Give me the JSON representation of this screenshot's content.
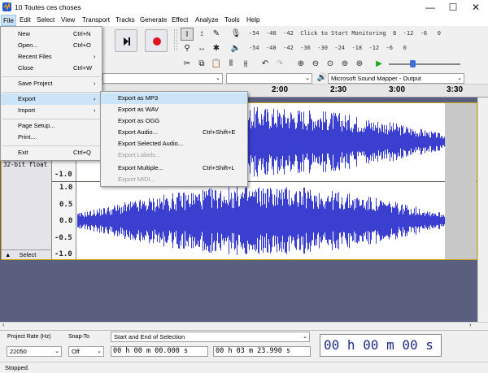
{
  "window": {
    "title": "10 Toutes ces choses",
    "minimize": "—",
    "maximize": "☐",
    "close": "✕"
  },
  "menubar": {
    "items": [
      "File",
      "Edit",
      "Select",
      "View",
      "Transport",
      "Tracks",
      "Generate",
      "Effect",
      "Analyze",
      "Tools",
      "Help"
    ]
  },
  "file_menu": {
    "items": [
      {
        "label": "New",
        "shortcut": "Ctrl+N"
      },
      {
        "label": "Open...",
        "shortcut": "Ctrl+O"
      },
      {
        "label": "Recent Files",
        "shortcut": "›"
      },
      {
        "label": "Close",
        "shortcut": "Ctrl+W"
      },
      {
        "label": "Save Project",
        "shortcut": "›"
      },
      {
        "label": "Export",
        "shortcut": "›"
      },
      {
        "label": "Import",
        "shortcut": "›"
      },
      {
        "label": "Page Setup...",
        "shortcut": ""
      },
      {
        "label": "Print...",
        "shortcut": ""
      },
      {
        "label": "Exit",
        "shortcut": "Ctrl+Q"
      }
    ]
  },
  "export_menu": {
    "items": [
      {
        "label": "Export as MP3",
        "shortcut": ""
      },
      {
        "label": "Export as WAV",
        "shortcut": ""
      },
      {
        "label": "Export as OGG",
        "shortcut": ""
      },
      {
        "label": "Export Audio...",
        "shortcut": "Ctrl+Shift+E"
      },
      {
        "label": "Export Selected Audio...",
        "shortcut": ""
      },
      {
        "label": "Export Labels...",
        "shortcut": ""
      },
      {
        "label": "Export Multiple...",
        "shortcut": "Ctrl+Shift+L"
      },
      {
        "label": "Export MIDI...",
        "shortcut": ""
      }
    ]
  },
  "toolbar": {
    "meter_scale_top": "-54  -48  -42  Click to Start Monitoring  8  -12  -6   0",
    "meter_scale_bottom": "-54  -48  -42  -36  -30  -24  -18  -12  -6   0",
    "output_device": "Microsoft Sound Mapper - Output"
  },
  "timeline": {
    "ticks": [
      "2:00",
      "2:30",
      "3:00",
      "3:30"
    ]
  },
  "tracks": {
    "format": "32-bit float",
    "scale": [
      "-1.0",
      "1.0",
      "0.5",
      "0.0",
      "-0.5",
      "-1.0"
    ],
    "select_label": "Select"
  },
  "selection_toolbar": {
    "project_rate_label": "Project Rate (Hz)",
    "snap_to_label": "Snap-To",
    "project_rate": "22050",
    "snap_to": "Off",
    "selection_mode": "Start and End of Selection",
    "start_time": "00 h 00 m 00.000 s",
    "end_time": "00 h 03 m 23.990 s",
    "big_time": "00 h 00 m 00 s"
  },
  "status": {
    "text": "Stopped."
  },
  "colors": {
    "wave": "#3a3fcf",
    "track_bg": "#5a5f7f",
    "menu_highlight": "#cce4f7"
  }
}
